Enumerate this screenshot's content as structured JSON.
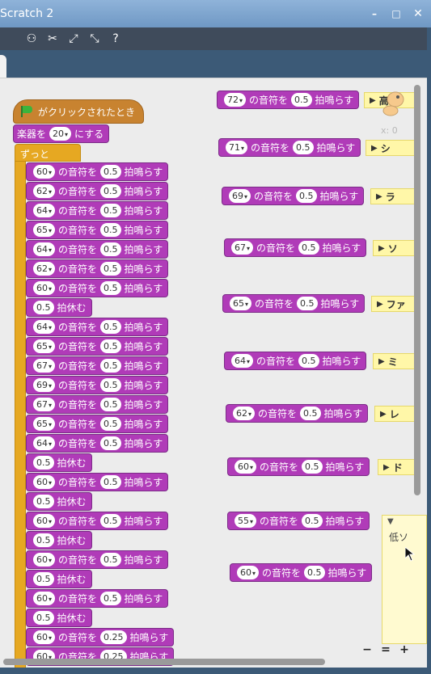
{
  "window": {
    "title": "Scratch 2",
    "min": "–",
    "max": "□",
    "close": "✕"
  },
  "toolbar": {
    "icons": [
      "duplicate-icon",
      "cut-icon",
      "grow-icon",
      "shrink-icon",
      "help-icon"
    ],
    "glyphs": [
      "⚇",
      "✂",
      "⤢",
      "⤡",
      "?"
    ]
  },
  "hat": {
    "label": "がクリックされたとき"
  },
  "instrument": {
    "prefix": "楽器を",
    "value": "20",
    "suffix": "にする"
  },
  "forever": {
    "label": "ずっと"
  },
  "labels": {
    "note_of": "の音符を",
    "beats": "拍鳴らす",
    "rest": "拍休む",
    "arrow": "▾"
  },
  "main_script": [
    {
      "type": "note",
      "note": "60",
      "beats": "0.5"
    },
    {
      "type": "note",
      "note": "62",
      "beats": "0.5"
    },
    {
      "type": "note",
      "note": "64",
      "beats": "0.5"
    },
    {
      "type": "note",
      "note": "65",
      "beats": "0.5"
    },
    {
      "type": "note",
      "note": "64",
      "beats": "0.5"
    },
    {
      "type": "note",
      "note": "62",
      "beats": "0.5"
    },
    {
      "type": "note",
      "note": "60",
      "beats": "0.5"
    },
    {
      "type": "rest",
      "beats": "0.5"
    },
    {
      "type": "note",
      "note": "64",
      "beats": "0.5"
    },
    {
      "type": "note",
      "note": "65",
      "beats": "0.5"
    },
    {
      "type": "note",
      "note": "67",
      "beats": "0.5"
    },
    {
      "type": "note",
      "note": "69",
      "beats": "0.5"
    },
    {
      "type": "note",
      "note": "67",
      "beats": "0.5"
    },
    {
      "type": "note",
      "note": "65",
      "beats": "0.5"
    },
    {
      "type": "note",
      "note": "64",
      "beats": "0.5"
    },
    {
      "type": "rest",
      "beats": "0.5"
    },
    {
      "type": "note",
      "note": "60",
      "beats": "0.5"
    },
    {
      "type": "rest",
      "beats": "0.5"
    },
    {
      "type": "note",
      "note": "60",
      "beats": "0.5"
    },
    {
      "type": "rest",
      "beats": "0.5"
    },
    {
      "type": "note",
      "note": "60",
      "beats": "0.5"
    },
    {
      "type": "rest",
      "beats": "0.5"
    },
    {
      "type": "note",
      "note": "60",
      "beats": "0.5"
    },
    {
      "type": "rest",
      "beats": "0.5"
    },
    {
      "type": "note",
      "note": "60",
      "beats": "0.25"
    },
    {
      "type": "note",
      "note": "60",
      "beats": "0.25"
    }
  ],
  "side_blocks": [
    {
      "note": "72",
      "beats": "0.5",
      "comment": "高ド"
    },
    {
      "note": "71",
      "beats": "0.5",
      "comment": "シ"
    },
    {
      "note": "69",
      "beats": "0.5",
      "comment": "ラ"
    },
    {
      "note": "67",
      "beats": "0.5",
      "comment": "ソ"
    },
    {
      "note": "65",
      "beats": "0.5",
      "comment": "ファ"
    },
    {
      "note": "64",
      "beats": "0.5",
      "comment": "ミ"
    },
    {
      "note": "62",
      "beats": "0.5",
      "comment": "レ"
    },
    {
      "note": "60",
      "beats": "0.5",
      "comment": "ド"
    },
    {
      "note": "55",
      "beats": "0.5",
      "comment": "低ソ"
    },
    {
      "note": "60",
      "beats": "0.5",
      "comment": ""
    }
  ],
  "sprite": {
    "x_label": "x: 0"
  },
  "zoom": {
    "out": "−",
    "reset": "=",
    "in": "+"
  },
  "colors": {
    "sound": "#a43fb1",
    "control": "#e6a822",
    "event": "#c88330",
    "comment": "#fff7a8"
  }
}
